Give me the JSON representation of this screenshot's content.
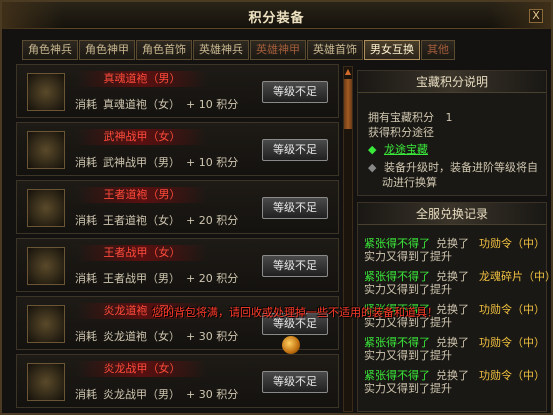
{
  "window": {
    "title": "积分装备",
    "close_glyph": "X"
  },
  "tabs": [
    {
      "label": "角色神兵",
      "active": false,
      "dim": false
    },
    {
      "label": "角色神甲",
      "active": false,
      "dim": false
    },
    {
      "label": "角色首饰",
      "active": false,
      "dim": false
    },
    {
      "label": "英雄神兵",
      "active": false,
      "dim": false
    },
    {
      "label": "英雄神甲",
      "active": false,
      "dim": true
    },
    {
      "label": "英雄首饰",
      "active": false,
      "dim": false
    },
    {
      "label": "男女互换",
      "active": true,
      "dim": false
    },
    {
      "label": "其他",
      "active": false,
      "dim": true
    }
  ],
  "items": [
    {
      "name": "真魂道袍（男）",
      "cost_label": "消耗",
      "cost_item": "真魂道袍（女）",
      "cost_amount": "+ 10 积分",
      "button": "等级不足",
      "icon": "robe-icon"
    },
    {
      "name": "武神战甲（女）",
      "cost_label": "消耗",
      "cost_item": "武神战甲（男）",
      "cost_amount": "+ 10 积分",
      "button": "等级不足",
      "icon": "armor-icon"
    },
    {
      "name": "王者道袍（男）",
      "cost_label": "消耗",
      "cost_item": "王者道袍（女）",
      "cost_amount": "+ 20 积分",
      "button": "等级不足",
      "icon": "robe-icon"
    },
    {
      "name": "王者战甲（女）",
      "cost_label": "消耗",
      "cost_item": "王者战甲（男）",
      "cost_amount": "+ 20 积分",
      "button": "等级不足",
      "icon": "armor-icon"
    },
    {
      "name": "炎龙道袍（男）",
      "cost_label": "消耗",
      "cost_item": "炎龙道袍（女）",
      "cost_amount": "+ 30 积分",
      "button": "等级不足",
      "icon": "robe-icon"
    },
    {
      "name": "炎龙战甲（女）",
      "cost_label": "消耗",
      "cost_item": "炎龙战甲（男）",
      "cost_amount": "+ 30 积分",
      "button": "等级不足",
      "icon": "armor-icon"
    }
  ],
  "info_panel": {
    "title": "宝藏积分说明",
    "points_label": "拥有宝藏积分",
    "points_value": "1",
    "obtain_label": "获得积分途径",
    "link": "龙途宝藏",
    "note_line1": "装备升级时，装备进阶等级将自",
    "note_line2": "动进行换算"
  },
  "records_panel": {
    "title": "全服兑换记录",
    "records": [
      {
        "player": "紧张得不得了",
        "action": "兑换了",
        "item": "功勋令（中）",
        "desc": "实力又得到了提升"
      },
      {
        "player": "紧张得不得了",
        "action": "兑换了",
        "item": "龙魂碎片（中）",
        "desc": "实力又得到了提升"
      },
      {
        "player": "紧张得不得了",
        "action": "兑换了",
        "item": "功勋令（中）",
        "desc": "实力又得到了提升"
      },
      {
        "player": "紧张得不得了",
        "action": "兑换了",
        "item": "功勋令（中）",
        "desc": "实力又得到了提升"
      },
      {
        "player": "紧张得不得了",
        "action": "兑换了",
        "item": "功勋令（中）",
        "desc": "实力又得到了提升"
      }
    ]
  },
  "toast": "您的背包将满，请回收或处理掉一些不适用的装备和道具！"
}
